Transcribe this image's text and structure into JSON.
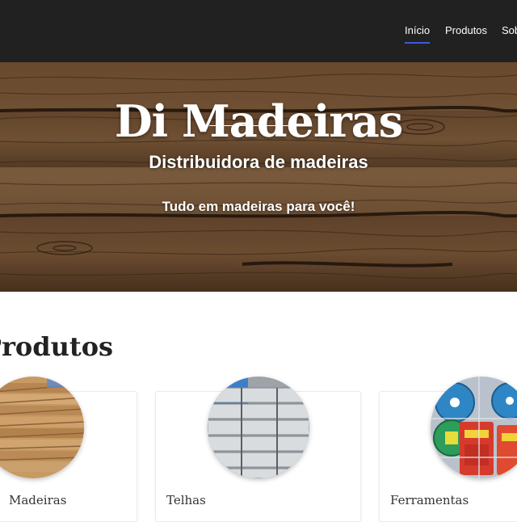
{
  "nav": {
    "items": [
      {
        "label": "Início",
        "active": true
      },
      {
        "label": "Produtos",
        "active": false
      },
      {
        "label": "Sobre",
        "active": false
      }
    ]
  },
  "hero": {
    "title": "Di Madeiras",
    "subtitle": "Distribuidora de madeiras",
    "tagline": "Tudo em madeiras para você!"
  },
  "products": {
    "title": "Produtos",
    "items": [
      {
        "label": "Madeiras",
        "image": "lumber-stack"
      },
      {
        "label": "Telhas",
        "image": "roof-tiles-stack"
      },
      {
        "label": "Ferramentas",
        "image": "tools-display"
      }
    ]
  },
  "colors": {
    "nav_bg": "#212121",
    "nav_active_underline": "#3b5bdb",
    "wood_dark": "#3e2a1a",
    "wood_mid": "#6b4a2f",
    "wood_light": "#9a7350"
  }
}
